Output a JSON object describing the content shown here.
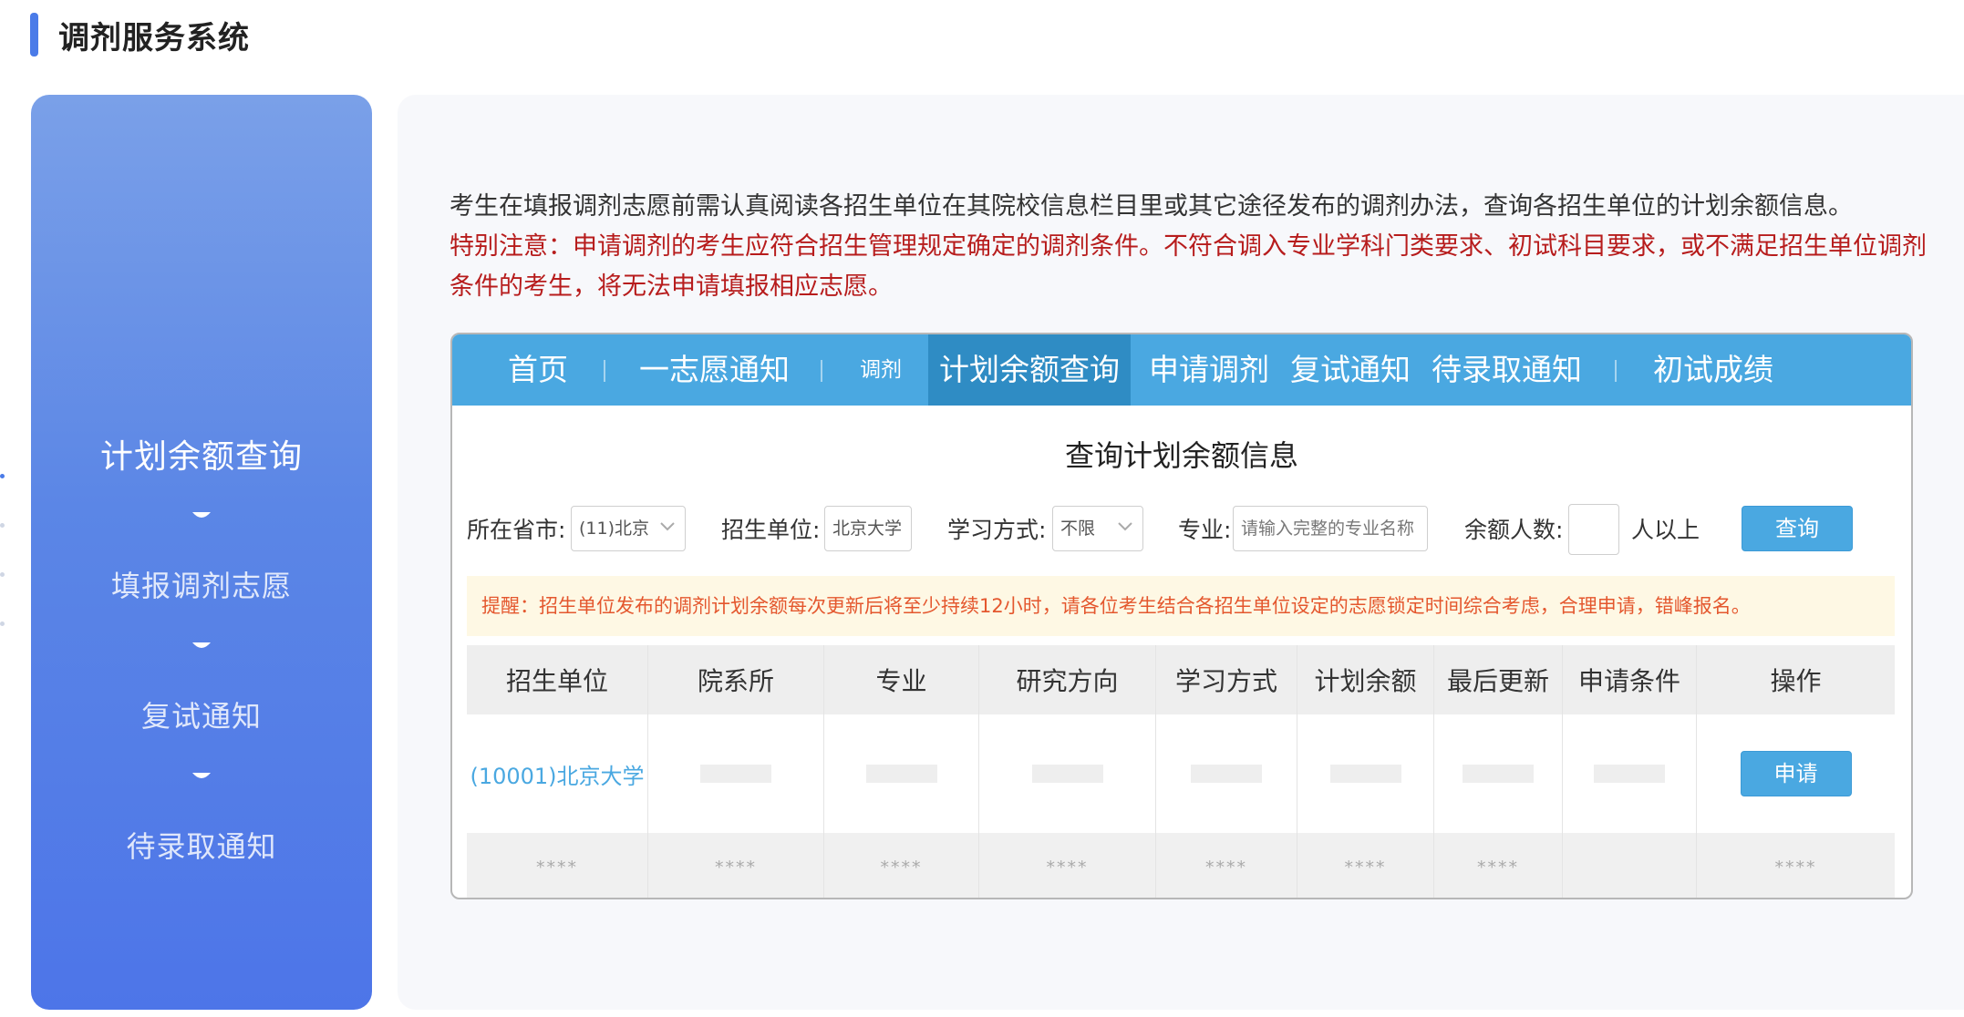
{
  "header": {
    "title": "调剂服务系统"
  },
  "sidebar": {
    "steps": [
      {
        "label": "计划余额查询",
        "active": true
      },
      {
        "label": "填报调剂志愿",
        "active": false
      },
      {
        "label": "复试通知",
        "active": false
      },
      {
        "label": "待录取通知",
        "active": false
      }
    ]
  },
  "notice": {
    "normal": "考生在填报调剂志愿前需认真阅读各招生单位在其院校信息栏目里或其它途径发布的调剂办法，查询各招生单位的计划余额信息。",
    "warning": "特别注意：申请调剂的考生应符合招生管理规定确定的调剂条件。不符合调入专业学科门类要求、初试科目要求，或不满足招生单位调剂条件的考生，将无法申请填报相应志愿。"
  },
  "nav": {
    "items": [
      "首页",
      "一志愿通知",
      "调剂",
      "计划余额查询",
      "申请调剂",
      "复试通知",
      "待录取通知",
      "初试成绩"
    ],
    "active_index": 3
  },
  "query": {
    "title": "查询计划余额信息",
    "province_label": "所在省市:",
    "province_value": "(11)北京",
    "unit_label": "招生单位:",
    "unit_value": "北京大学",
    "mode_label": "学习方式:",
    "mode_value": "不限",
    "major_label": "专业:",
    "major_placeholder": "请输入完整的专业名称",
    "remain_label": "余额人数:",
    "remain_value": "",
    "remain_suffix": "人以上",
    "search_button": "查询"
  },
  "tip": "提醒：招生单位发布的调剂计划余额每次更新后将至少持续12小时，请各位考生结合各招生单位设定的志愿锁定时间综合考虑，合理申请，错峰报名。",
  "table": {
    "headers": [
      "招生单位",
      "院系所",
      "专业",
      "研究方向",
      "学习方式",
      "计划余额",
      "最后更新",
      "申请条件",
      "操作"
    ],
    "row": {
      "unit": "(10001)北京大学",
      "action": "申请"
    },
    "masked": [
      "****",
      "****",
      "****",
      "****",
      "****",
      "****",
      "****",
      "",
      "****"
    ]
  },
  "colors": {
    "accent": "#4a7be8",
    "nav_blue": "#4aa8e1",
    "nav_active": "#2f8cc4",
    "warning_red": "#b71c1c",
    "tip_orange": "#e4572e"
  }
}
